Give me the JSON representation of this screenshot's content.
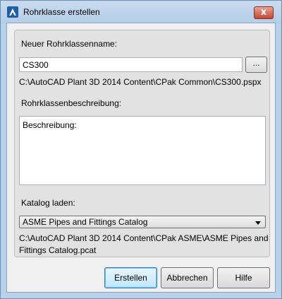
{
  "window": {
    "title": "Rohrklasse erstellen",
    "close_label": "x"
  },
  "form": {
    "name_label": "Neuer Rohrklassenname:",
    "name_value": "CS300",
    "browse_label": "...",
    "path": "C:\\AutoCAD Plant 3D 2014 Content\\CPak Common\\CS300.pspx",
    "description_label": "Rohrklassenbeschreibung:",
    "description_value": "Beschreibung:",
    "catalog_label": "Katalog laden:",
    "catalog_selected": "ASME Pipes and Fittings Catalog",
    "catalog_path_line1": "C:\\AutoCAD Plant 3D 2014 Content\\CPak ASME\\ASME Pipes and",
    "catalog_path_line2": "Fittings Catalog.pcat"
  },
  "buttons": {
    "create": "Erstellen",
    "cancel": "Abbrechen",
    "help": "Hilfe"
  },
  "colors": {
    "titlebar": "#b8d0ea",
    "close_button": "#c74634",
    "default_button": "#bee6fd"
  }
}
